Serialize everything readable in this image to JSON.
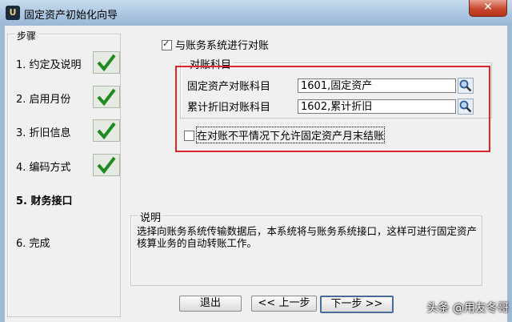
{
  "window": {
    "title": "固定资产初始化向导",
    "close_label": "✕",
    "app_icon_label": "U"
  },
  "steps": {
    "title": "步骤",
    "items": [
      {
        "label": "1. 约定及说明",
        "done": true
      },
      {
        "label": "2. 启用月份",
        "done": true
      },
      {
        "label": "3. 折旧信息",
        "done": true
      },
      {
        "label": "4. 编码方式",
        "done": true
      },
      {
        "label": "5. 财务接口",
        "done": false,
        "current": true
      },
      {
        "label": "6. 完成",
        "done": false
      }
    ]
  },
  "reconcile": {
    "enable_label": "与账务系统进行对账",
    "enable_checked": true,
    "group_title": "对账科目",
    "asset_label": "固定资产对账科目",
    "asset_value": "1601,固定资产",
    "depr_label": "累计折旧对账科目",
    "depr_value": "1602,累计折旧",
    "allow_label": "在对账不平情况下允许固定资产月末结账",
    "allow_checked": false
  },
  "note": {
    "title": "说明",
    "text": "选择向账务系统传输数据后，本系统将与账务系统接口，这样可进行固定资产核算业务的自动转账工作。"
  },
  "buttons": {
    "exit": "退出",
    "prev": "<< 上一步",
    "next": "下一步 >>"
  },
  "watermark": "头条 @用友冬哥",
  "colors": {
    "highlight_border": "#e0262b",
    "check_green": "#1f8a1f"
  }
}
